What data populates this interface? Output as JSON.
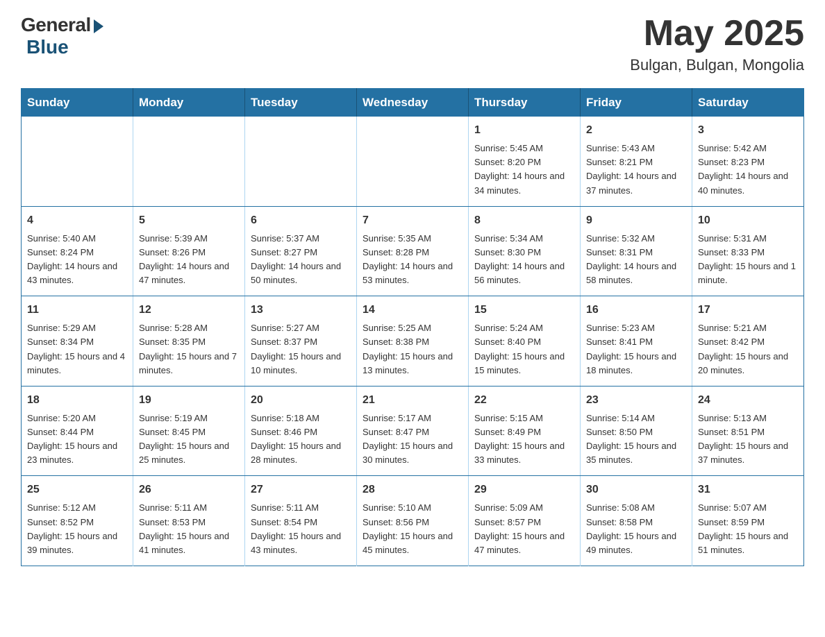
{
  "header": {
    "logo": {
      "general": "General",
      "blue": "Blue"
    },
    "month": "May 2025",
    "location": "Bulgan, Bulgan, Mongolia"
  },
  "weekdays": [
    "Sunday",
    "Monday",
    "Tuesday",
    "Wednesday",
    "Thursday",
    "Friday",
    "Saturday"
  ],
  "weeks": [
    [
      {
        "day": "",
        "info": ""
      },
      {
        "day": "",
        "info": ""
      },
      {
        "day": "",
        "info": ""
      },
      {
        "day": "",
        "info": ""
      },
      {
        "day": "1",
        "info": "Sunrise: 5:45 AM\nSunset: 8:20 PM\nDaylight: 14 hours and 34 minutes."
      },
      {
        "day": "2",
        "info": "Sunrise: 5:43 AM\nSunset: 8:21 PM\nDaylight: 14 hours and 37 minutes."
      },
      {
        "day": "3",
        "info": "Sunrise: 5:42 AM\nSunset: 8:23 PM\nDaylight: 14 hours and 40 minutes."
      }
    ],
    [
      {
        "day": "4",
        "info": "Sunrise: 5:40 AM\nSunset: 8:24 PM\nDaylight: 14 hours and 43 minutes."
      },
      {
        "day": "5",
        "info": "Sunrise: 5:39 AM\nSunset: 8:26 PM\nDaylight: 14 hours and 47 minutes."
      },
      {
        "day": "6",
        "info": "Sunrise: 5:37 AM\nSunset: 8:27 PM\nDaylight: 14 hours and 50 minutes."
      },
      {
        "day": "7",
        "info": "Sunrise: 5:35 AM\nSunset: 8:28 PM\nDaylight: 14 hours and 53 minutes."
      },
      {
        "day": "8",
        "info": "Sunrise: 5:34 AM\nSunset: 8:30 PM\nDaylight: 14 hours and 56 minutes."
      },
      {
        "day": "9",
        "info": "Sunrise: 5:32 AM\nSunset: 8:31 PM\nDaylight: 14 hours and 58 minutes."
      },
      {
        "day": "10",
        "info": "Sunrise: 5:31 AM\nSunset: 8:33 PM\nDaylight: 15 hours and 1 minute."
      }
    ],
    [
      {
        "day": "11",
        "info": "Sunrise: 5:29 AM\nSunset: 8:34 PM\nDaylight: 15 hours and 4 minutes."
      },
      {
        "day": "12",
        "info": "Sunrise: 5:28 AM\nSunset: 8:35 PM\nDaylight: 15 hours and 7 minutes."
      },
      {
        "day": "13",
        "info": "Sunrise: 5:27 AM\nSunset: 8:37 PM\nDaylight: 15 hours and 10 minutes."
      },
      {
        "day": "14",
        "info": "Sunrise: 5:25 AM\nSunset: 8:38 PM\nDaylight: 15 hours and 13 minutes."
      },
      {
        "day": "15",
        "info": "Sunrise: 5:24 AM\nSunset: 8:40 PM\nDaylight: 15 hours and 15 minutes."
      },
      {
        "day": "16",
        "info": "Sunrise: 5:23 AM\nSunset: 8:41 PM\nDaylight: 15 hours and 18 minutes."
      },
      {
        "day": "17",
        "info": "Sunrise: 5:21 AM\nSunset: 8:42 PM\nDaylight: 15 hours and 20 minutes."
      }
    ],
    [
      {
        "day": "18",
        "info": "Sunrise: 5:20 AM\nSunset: 8:44 PM\nDaylight: 15 hours and 23 minutes."
      },
      {
        "day": "19",
        "info": "Sunrise: 5:19 AM\nSunset: 8:45 PM\nDaylight: 15 hours and 25 minutes."
      },
      {
        "day": "20",
        "info": "Sunrise: 5:18 AM\nSunset: 8:46 PM\nDaylight: 15 hours and 28 minutes."
      },
      {
        "day": "21",
        "info": "Sunrise: 5:17 AM\nSunset: 8:47 PM\nDaylight: 15 hours and 30 minutes."
      },
      {
        "day": "22",
        "info": "Sunrise: 5:15 AM\nSunset: 8:49 PM\nDaylight: 15 hours and 33 minutes."
      },
      {
        "day": "23",
        "info": "Sunrise: 5:14 AM\nSunset: 8:50 PM\nDaylight: 15 hours and 35 minutes."
      },
      {
        "day": "24",
        "info": "Sunrise: 5:13 AM\nSunset: 8:51 PM\nDaylight: 15 hours and 37 minutes."
      }
    ],
    [
      {
        "day": "25",
        "info": "Sunrise: 5:12 AM\nSunset: 8:52 PM\nDaylight: 15 hours and 39 minutes."
      },
      {
        "day": "26",
        "info": "Sunrise: 5:11 AM\nSunset: 8:53 PM\nDaylight: 15 hours and 41 minutes."
      },
      {
        "day": "27",
        "info": "Sunrise: 5:11 AM\nSunset: 8:54 PM\nDaylight: 15 hours and 43 minutes."
      },
      {
        "day": "28",
        "info": "Sunrise: 5:10 AM\nSunset: 8:56 PM\nDaylight: 15 hours and 45 minutes."
      },
      {
        "day": "29",
        "info": "Sunrise: 5:09 AM\nSunset: 8:57 PM\nDaylight: 15 hours and 47 minutes."
      },
      {
        "day": "30",
        "info": "Sunrise: 5:08 AM\nSunset: 8:58 PM\nDaylight: 15 hours and 49 minutes."
      },
      {
        "day": "31",
        "info": "Sunrise: 5:07 AM\nSunset: 8:59 PM\nDaylight: 15 hours and 51 minutes."
      }
    ]
  ]
}
